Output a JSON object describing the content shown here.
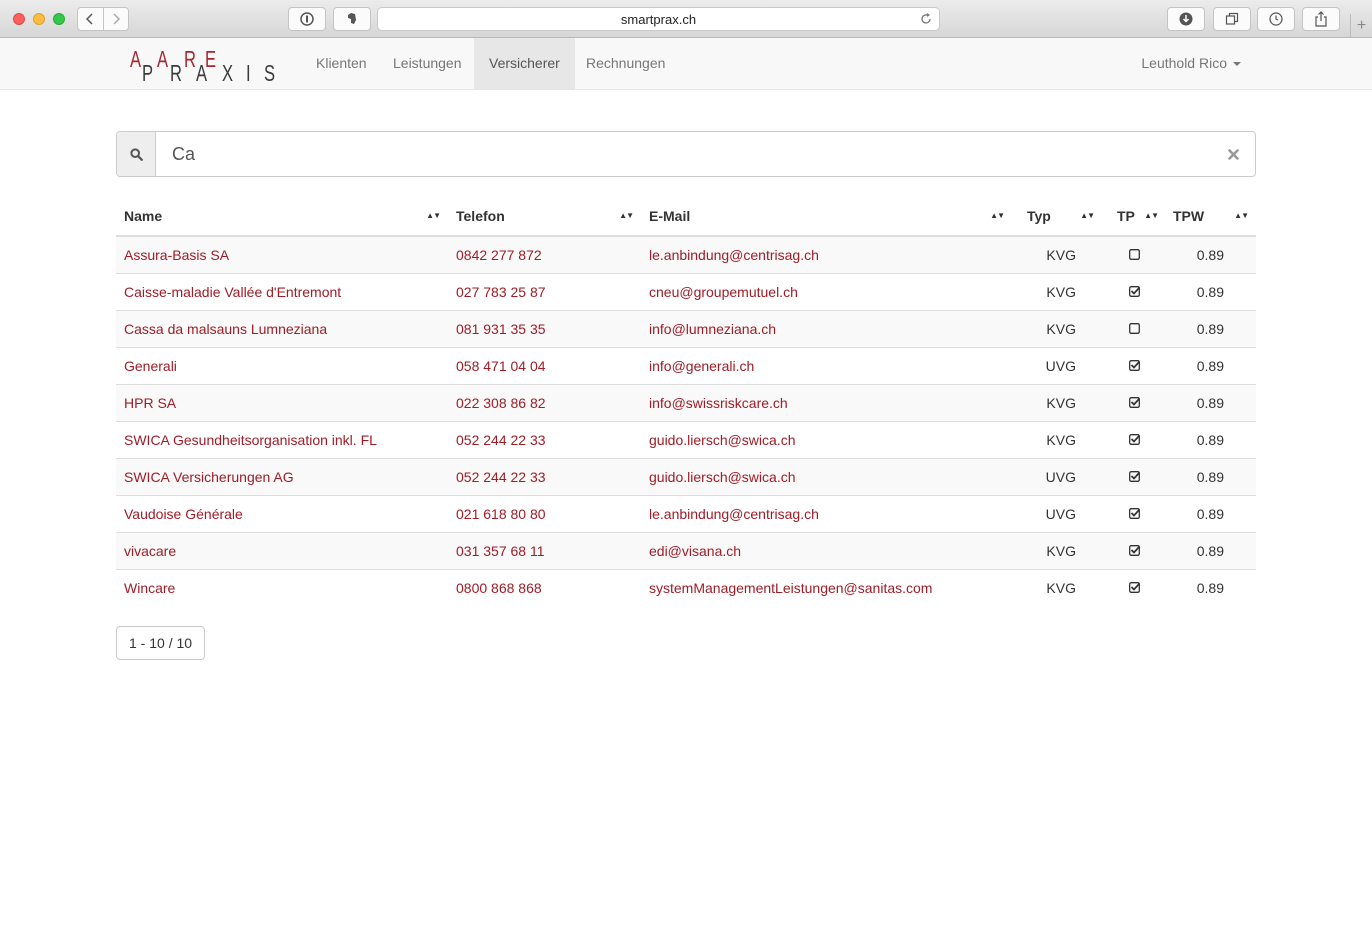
{
  "browser": {
    "url": "smartprax.ch"
  },
  "logo": {
    "letters_top": [
      "A",
      "A",
      "R",
      "E"
    ],
    "letters_bottom": [
      "P",
      "R",
      "A",
      "X",
      "I",
      "S"
    ]
  },
  "nav": {
    "items": [
      {
        "label": "Klienten",
        "active": false
      },
      {
        "label": "Leistungen",
        "active": false
      },
      {
        "label": "Versicherer",
        "active": true
      },
      {
        "label": "Rechnungen",
        "active": false
      }
    ],
    "user": "Leuthold Rico"
  },
  "search": {
    "value": "Ca"
  },
  "table": {
    "headers": {
      "name": "Name",
      "telefon": "Telefon",
      "email": "E-Mail",
      "typ": "Typ",
      "tp": "TP",
      "tpw": "TPW"
    },
    "rows": [
      {
        "name": "Assura-Basis SA",
        "telefon": "0842 277 872",
        "email": "le.anbindung@centrisag.ch",
        "typ": "KVG",
        "tp": false,
        "tpw": "0.89"
      },
      {
        "name": "Caisse-maladie Vallée d'Entremont",
        "telefon": "027 783 25 87",
        "email": "cneu@groupemutuel.ch",
        "typ": "KVG",
        "tp": true,
        "tpw": "0.89"
      },
      {
        "name": "Cassa da malsauns Lumneziana",
        "telefon": "081 931 35 35",
        "email": "info@lumneziana.ch",
        "typ": "KVG",
        "tp": false,
        "tpw": "0.89"
      },
      {
        "name": "Generali",
        "telefon": "058 471 04 04",
        "email": "info@generali.ch",
        "typ": "UVG",
        "tp": true,
        "tpw": "0.89"
      },
      {
        "name": "HPR SA",
        "telefon": "022 308 86 82",
        "email": "info@swissriskcare.ch",
        "typ": "KVG",
        "tp": true,
        "tpw": "0.89"
      },
      {
        "name": "SWICA Gesundheitsorganisation inkl. FL",
        "telefon": "052 244 22 33",
        "email": "guido.liersch@swica.ch",
        "typ": "KVG",
        "tp": true,
        "tpw": "0.89"
      },
      {
        "name": "SWICA Versicherungen AG",
        "telefon": "052 244 22 33",
        "email": "guido.liersch@swica.ch",
        "typ": "UVG",
        "tp": true,
        "tpw": "0.89"
      },
      {
        "name": "Vaudoise Générale",
        "telefon": "021 618 80 80",
        "email": "le.anbindung@centrisag.ch",
        "typ": "UVG",
        "tp": true,
        "tpw": "0.89"
      },
      {
        "name": "vivacare",
        "telefon": "031 357 68 11",
        "email": "edi@visana.ch",
        "typ": "KVG",
        "tp": true,
        "tpw": "0.89"
      },
      {
        "name": "Wincare",
        "telefon": "0800 868 868",
        "email": "systemManagementLeistungen@sanitas.com",
        "typ": "KVG",
        "tp": true,
        "tpw": "0.89"
      }
    ]
  },
  "pagination": {
    "label": "1 - 10 / 10"
  },
  "colors": {
    "link": "#a01c26",
    "logo_accent": "#a8262e",
    "nav_active_bg": "#e7e7e7"
  }
}
